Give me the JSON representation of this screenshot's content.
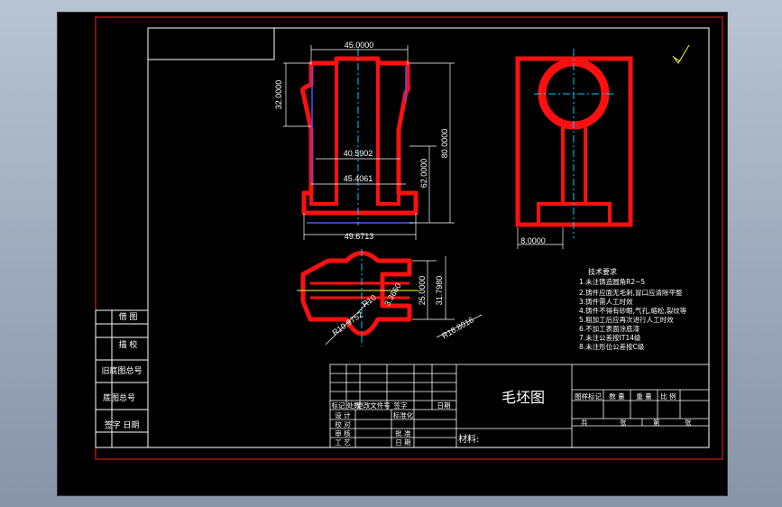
{
  "drawing": {
    "title": "毛坯图",
    "material_label": "材料:",
    "dimensions": {
      "top_width": "45.0000",
      "top_height": "32.0000",
      "neck_width": "40.5902",
      "lower_width": "45.4061",
      "base_width": "49.6713",
      "height_62": "62.0000",
      "height_80": "80.0000",
      "side_offset": "8.0000",
      "plan_25": "25.0000",
      "plan_31": "31.7980",
      "plan_3": "3.3660",
      "radius_a": "R10",
      "radius_b": "R10.9752",
      "radius_c": "R16.8016"
    },
    "tech_requirements": {
      "heading": "技术要求",
      "items": [
        "1.未注铸造圆角R2~5",
        "2.铸件应面无毛刺,冒口应清除平整",
        "3.铸件需人工时效",
        "4.铸件不得有砂眼,气孔,缩松,裂纹等",
        "5.粗加工后应再次进行人工时效",
        "6.不加工表面涂底漆",
        "7.未注公差按IT14级",
        "8.未注形位公差按C级"
      ]
    },
    "left_panel": [
      "借 图",
      "描 校",
      "旧底图总号",
      "底图总号",
      "签字 日期"
    ],
    "title_block": {
      "rev_headers": [
        "标记",
        "处数",
        "更改文件号",
        "签字",
        "日期"
      ],
      "rows": [
        "设 计",
        "校 对",
        "审 核",
        "工 艺"
      ],
      "standardization": "标准化",
      "approve": "批 准",
      "date": "日 期",
      "scale_headers": [
        "图样标记",
        "数 量",
        "重 量",
        "比 例"
      ],
      "sheet": [
        "共",
        "张",
        "第",
        "张"
      ]
    }
  }
}
